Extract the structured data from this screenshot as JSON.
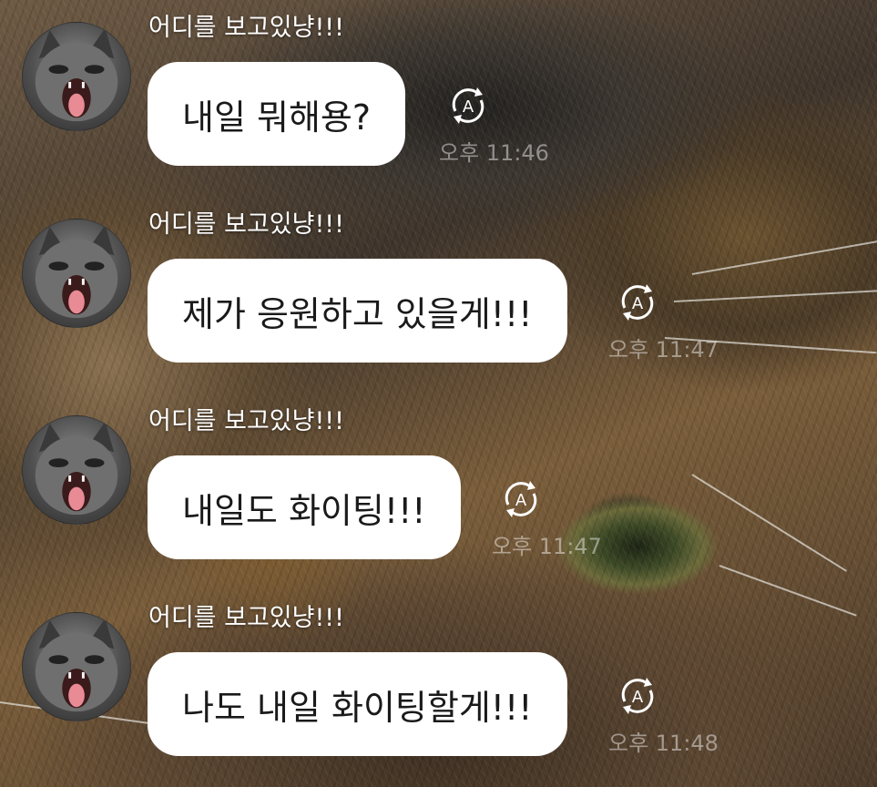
{
  "messages": [
    {
      "sender": "어디를 보고있냥!!!",
      "text": "내일 뭐해용?",
      "time": "오후 11:46"
    },
    {
      "sender": "어디를 보고있냥!!!",
      "text": "제가 응원하고 있을게!!!",
      "time": "오후 11:47"
    },
    {
      "sender": "어디를 보고있냥!!!",
      "text": "내일도 화이팅!!!",
      "time": "오후 11:47"
    },
    {
      "sender": "어디를 보고있냥!!!",
      "text": "나도 내일 화이팅할게!!!",
      "time": "오후 11:48"
    }
  ],
  "icons": {
    "translate": "translate-icon",
    "avatar": "cat-avatar"
  },
  "colors": {
    "bubble": "#ffffff",
    "text": "#1a1a1a",
    "sender": "#ffffff"
  }
}
